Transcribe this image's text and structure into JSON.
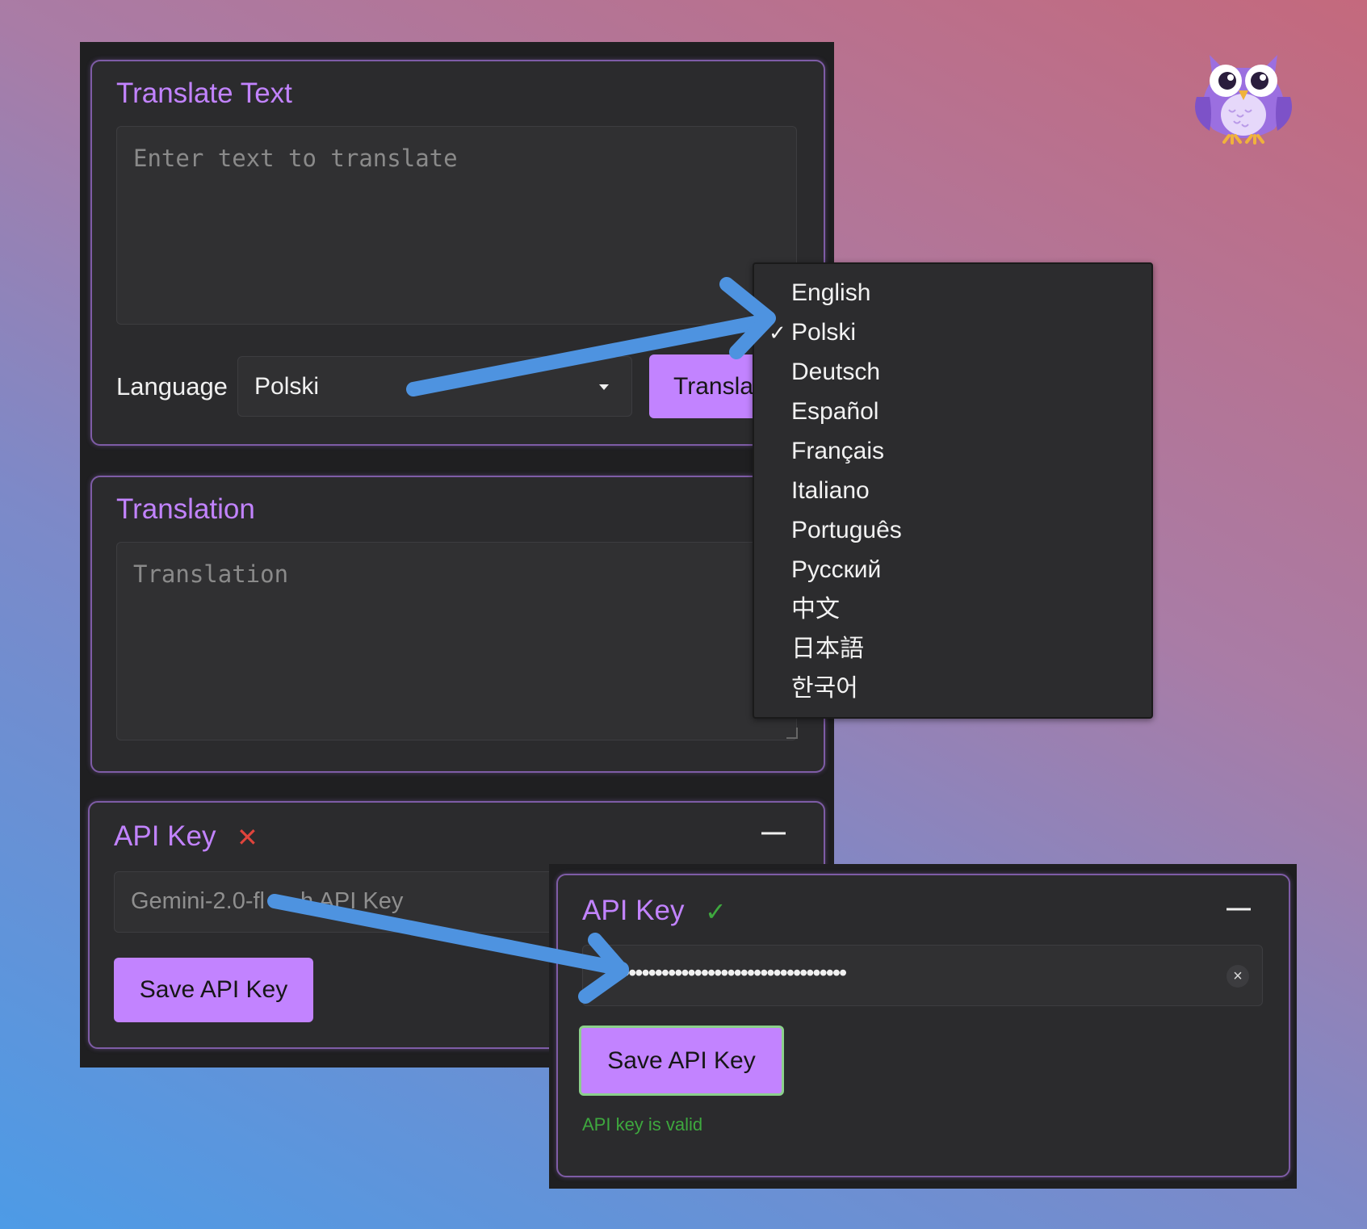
{
  "translate_panel": {
    "title": "Translate Text",
    "input_placeholder": "Enter text to translate",
    "language_label": "Language",
    "language_value": "Polski",
    "translate_button": "Transla"
  },
  "language_menu": {
    "options": [
      "English",
      "Polski",
      "Deutsch",
      "Español",
      "Français",
      "Italiano",
      "Português",
      "Русский",
      "中文",
      "日本語",
      "한국어"
    ],
    "checked_mark": "✓"
  },
  "translation_panel": {
    "title": "Translation",
    "output_placeholder": "Translation"
  },
  "api_key_panel": {
    "title": "API Key",
    "status_icon": "✕",
    "collapse_icon": "—",
    "input_placeholder_visible": "Gemini-2.0-fl",
    "input_placeholder_tail": "h API Key",
    "save_button": "Save API Key"
  },
  "api_key_valid_panel": {
    "title": "API Key",
    "status_icon": "✓",
    "collapse_icon": "—",
    "masked_value": "••••••••••••••••••••••••••••••••••",
    "clear_icon": "×",
    "save_button": "Save API Key",
    "status_message": "API key is valid"
  },
  "colors": {
    "accent": "#c283ff",
    "panel_bg": "#2b2b2d",
    "arrow": "#4e93e0",
    "error": "#e0443c",
    "success": "#3ea83e"
  },
  "icons": {
    "mascot": "owl-icon",
    "dropdown": "caret-down-icon",
    "arrows": "arrow-icon"
  }
}
